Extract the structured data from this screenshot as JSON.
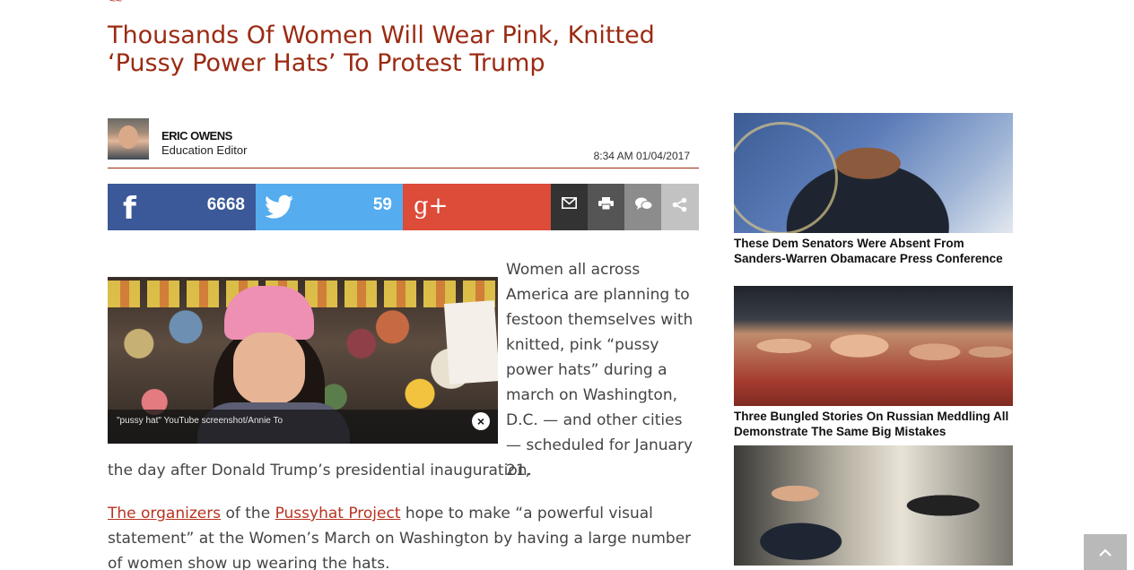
{
  "article": {
    "headline": "Thousands Of Women Will Wear Pink, Knitted ‘Pussy Power Hats’ To Protest Trump",
    "author": {
      "name": "ERIC OWENS",
      "title": "Education Editor"
    },
    "timestamp": "8:34 AM 01/04/2017",
    "image_caption": "\"pussy hat\" YouTube screenshot/Annie To",
    "paragraph1_wrap": "Women all across America are planning to festoon themselves with knitted, pink “pussy power hats” during a march on Washington, D.C. — and other cities — scheduled for January 21,",
    "paragraph1_full": "the day after Donald Trump’s presidential inauguration.",
    "paragraph2": {
      "link1": "The organizers",
      "text1": " of the ",
      "link2": "Pussyhat Project",
      "text2": " hope to make “a powerful visual statement” at the Women’s March on Washington by having a large number of women show up wearing the hats."
    }
  },
  "share": {
    "facebook_count": "6668",
    "twitter_count": "59",
    "colors": {
      "facebook": "#3b5998",
      "twitter": "#55acee",
      "google_plus": "#dd4b39"
    }
  },
  "sidebar": {
    "items": [
      {
        "title": "These Dem Senators Were Absent From Sanders-Warren Obamacare Press Conference"
      },
      {
        "title": "Three Bungled Stories On Russian Meddling All Demonstrate The Same Big Mistakes"
      },
      {
        "title": ""
      }
    ]
  },
  "icons": {
    "facebook": "facebook-icon",
    "twitter": "twitter-icon",
    "google_plus": "google-plus-icon",
    "email": "email-icon",
    "print": "print-icon",
    "comment": "comment-icon",
    "share": "share-icon",
    "close": "close-icon",
    "scroll_top": "chevron-up-icon"
  },
  "theme": {
    "headline_color": "#9b2a12",
    "link_color": "#b83321"
  }
}
